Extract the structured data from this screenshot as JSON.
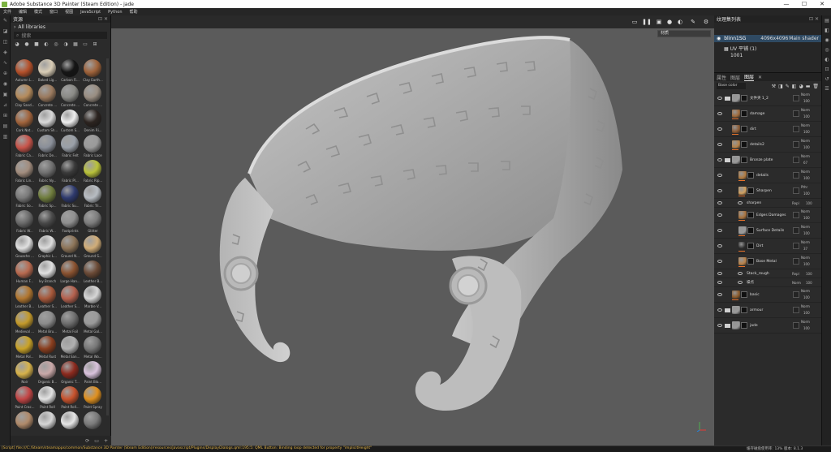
{
  "window": {
    "title": "Adobe Substance 3D Painter (Steam Edition) - jade",
    "controls": [
      "—",
      "☐",
      "✕"
    ]
  },
  "menu": [
    "文件",
    "编辑",
    "模式",
    "窗口",
    "视图",
    "JavaScript",
    "Python",
    "帮助"
  ],
  "shelf": {
    "title": "资源",
    "library": "All libraries",
    "search_placeholder": "搜索",
    "materials": [
      {
        "label": "Autumn L...",
        "color": "#b5502a"
      },
      {
        "label": "Baked Lig...",
        "color": "#d9cdb6"
      },
      {
        "label": "Carbon Fi...",
        "color": "#151515"
      },
      {
        "label": "Clay Earth...",
        "color": "#a0633a"
      },
      {
        "label": "Clay Sand...",
        "color": "#b58b5c"
      },
      {
        "label": "Concrete ...",
        "color": "#9b7a5e"
      },
      {
        "label": "Concrete ...",
        "color": "#8a8a86"
      },
      {
        "label": "Concrete ...",
        "color": "#9a8e82"
      },
      {
        "label": "Cork Nat...",
        "color": "#a2643c"
      },
      {
        "label": "Custom Sh...",
        "color": "#d9d9d9"
      },
      {
        "label": "Custom S...",
        "color": "#efefef"
      },
      {
        "label": "Denim Ri...",
        "color": "#2c2420"
      },
      {
        "label": "Fabric Ca...",
        "color": "#c8544a"
      },
      {
        "label": "Fabric De...",
        "color": "#8a8f99"
      },
      {
        "label": "Fabric Felt",
        "color": "#9aa0a8"
      },
      {
        "label": "Fabric Lace",
        "color": "#9a9a9a"
      },
      {
        "label": "Fabric Lin...",
        "color": "#a28d7e"
      },
      {
        "label": "Fabric Ny...",
        "color": "#707070"
      },
      {
        "label": "Fabric Pl...",
        "color": "#3a3a3a"
      },
      {
        "label": "Fabric Rip...",
        "color": "#b9c23a"
      },
      {
        "label": "Fabric So...",
        "color": "#7a7a7a"
      },
      {
        "label": "Fabric Sp...",
        "color": "#6f7d3d"
      },
      {
        "label": "Fabric Su...",
        "color": "#2e3a6e"
      },
      {
        "label": "Fabric Tri...",
        "color": "#b7bcc2"
      },
      {
        "label": "Fabric W...",
        "color": "#6a6a6a"
      },
      {
        "label": "Fabric W...",
        "color": "#4a4a4a"
      },
      {
        "label": "Footprints",
        "color": "#8f8f8f"
      },
      {
        "label": "Glitter",
        "color": "#7d7d7d"
      },
      {
        "label": "Gouache ...",
        "color": "#e0e0e0"
      },
      {
        "label": "Graphic L...",
        "color": "#dcdcdc"
      },
      {
        "label": "Ground N...",
        "color": "#8d7458"
      },
      {
        "label": "Ground S...",
        "color": "#d1ad78"
      },
      {
        "label": "Human F...",
        "color": "#b96a4f"
      },
      {
        "label": "Ivy Branch",
        "color": "#e2e2e2"
      },
      {
        "label": "Large Han...",
        "color": "#8a5230"
      },
      {
        "label": "Leather B...",
        "color": "#6b4a36"
      },
      {
        "label": "Leather B...",
        "color": "#b1762f"
      },
      {
        "label": "Leather S...",
        "color": "#a7583a"
      },
      {
        "label": "Leather S...",
        "color": "#b5614e"
      },
      {
        "label": "Marble V...",
        "color": "#d6d6d6"
      },
      {
        "label": "Medieval ...",
        "color": "#c49a2a"
      },
      {
        "label": "Metal Bru...",
        "color": "#8c8c8c"
      },
      {
        "label": "Metal Foil",
        "color": "#6e6e6e"
      },
      {
        "label": "Metal Gal...",
        "color": "#9a9a9a"
      },
      {
        "label": "Metal Pol...",
        "color": "#c9a227"
      },
      {
        "label": "Metal Rust",
        "color": "#8a3e1e"
      },
      {
        "label": "Metal San...",
        "color": "#b0b0b0"
      },
      {
        "label": "Metal Wo...",
        "color": "#777777"
      },
      {
        "label": "Noir",
        "color": "#d7b24a"
      },
      {
        "label": "Organic B...",
        "color": "#c9a8a8"
      },
      {
        "label": "Organic T...",
        "color": "#8c2a1e"
      },
      {
        "label": "Paint Blo...",
        "color": "#d9c2dc"
      },
      {
        "label": "Paint Crac...",
        "color": "#c34545"
      },
      {
        "label": "Paint Roll",
        "color": "#e3e3e3"
      },
      {
        "label": "Paint Roll...",
        "color": "#c8522c"
      },
      {
        "label": "Paint Spray",
        "color": "#e0901e"
      },
      {
        "label": "",
        "color": "#b08a6a"
      },
      {
        "label": "",
        "color": "#d6d6d6"
      },
      {
        "label": "",
        "color": "#e6e6e6"
      },
      {
        "label": "",
        "color": "#7a7a7a"
      }
    ]
  },
  "viewport": {
    "display_mode": "材质",
    "toolbar_icons": [
      "camera-icon",
      "layout-icon",
      "pause-icon",
      "screenshot-icon",
      "envmap-icon",
      "display-icon",
      "brush-mode-icon",
      "paint-icon",
      "settings-icon"
    ]
  },
  "texture_set": {
    "title": "纹理集列表",
    "set_name": "blinn1SG",
    "resolution": "4096x4096",
    "shader": "Main shader",
    "uv": "UV 平铺 (1)",
    "udim": "1001"
  },
  "layers_panel": {
    "tabs": [
      "属性",
      "图层",
      "图层"
    ],
    "blend_mode": "Base color",
    "layers": [
      {
        "name": "文件夹 1_2",
        "type": "folder",
        "blend": "Norm",
        "opacity": "100",
        "thumb": "#9a9a9a"
      },
      {
        "name": "damage",
        "type": "fill",
        "blend": "Norm",
        "opacity": "100",
        "thumb": "#a06a3a"
      },
      {
        "name": "dirt",
        "type": "fill",
        "blend": "Norm",
        "opacity": "100",
        "thumb": "#8a5a34"
      },
      {
        "name": "details2",
        "type": "fill",
        "blend": "Norm",
        "opacity": "100",
        "thumb": "#b4824a"
      },
      {
        "name": "Bronze plate",
        "type": "folder",
        "blend": "Norm",
        "opacity": "67",
        "thumb": "#9a9a9a"
      },
      {
        "name": "details",
        "type": "fill",
        "blend": "Norm",
        "opacity": "100",
        "thumb": "#b07a40"
      },
      {
        "name": "Sharpen",
        "type": "filter",
        "blend": "Pthr",
        "opacity": "100",
        "thumb": "#d0a060"
      },
      {
        "name": "Edges Damages",
        "type": "fill",
        "blend": "Norm",
        "opacity": "100",
        "thumb": "#a9733e"
      },
      {
        "name": "Surface Details",
        "type": "fill",
        "blend": "Norm",
        "opacity": "100",
        "thumb": "#9a9a9a"
      },
      {
        "name": "Dirt",
        "type": "fill",
        "blend": "Norm",
        "opacity": "37",
        "thumb": "#2a2a2a"
      },
      {
        "name": "Base Metal",
        "type": "fill",
        "blend": "Norm",
        "opacity": "100",
        "thumb": "#b8824a"
      },
      {
        "name": "basic",
        "type": "fill",
        "blend": "Norm",
        "opacity": "100",
        "thumb": "#8a5a2a"
      },
      {
        "name": "armour",
        "type": "folder",
        "blend": "Norm",
        "opacity": "100",
        "thumb": "#9a9a9a"
      },
      {
        "name": "jade",
        "type": "folder",
        "blend": "Norm",
        "opacity": "100",
        "thumb": "#9a9a9a"
      }
    ],
    "sublayers": [
      {
        "name": "sharpen",
        "blend": "Repl",
        "opacity": "100"
      },
      {
        "name": "Stack_rough",
        "blend": "Repl",
        "opacity": "100"
      },
      {
        "name": "噪点",
        "blend": "Norm",
        "opacity": "100"
      }
    ]
  },
  "status": {
    "message": "[Script] file:///C:/Steam/steamapps/common/Substance 3D Painter (Steam Edition)/resources/javascript/Plugins/DisplayDialogs.qml:195:5: QML Button: Binding loop detected for property \"implicitHeight\"",
    "right": "缓存磁盘使用率: 13%  版本: 8.1.3"
  }
}
